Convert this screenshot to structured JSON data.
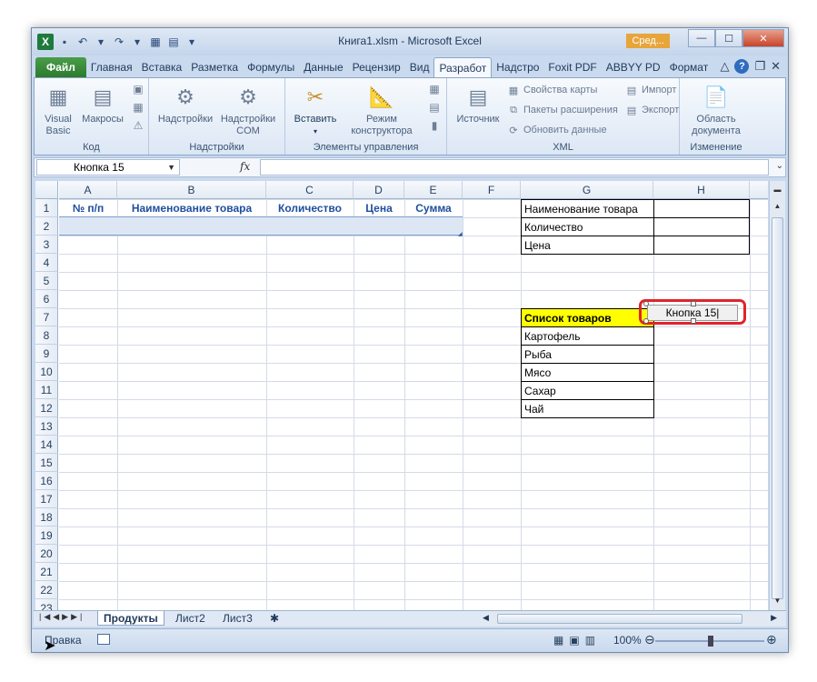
{
  "window": {
    "title": "Книга1.xlsm - Microsoft Excel",
    "search_badge": "Сред...",
    "controls": {
      "minimize": "—",
      "maximize": "☐",
      "close": "✕"
    }
  },
  "tabs": [
    {
      "label": "Файл",
      "active": false
    },
    {
      "label": "Главная"
    },
    {
      "label": "Вставка"
    },
    {
      "label": "Разметка"
    },
    {
      "label": "Формулы"
    },
    {
      "label": "Данные"
    },
    {
      "label": "Рецензир"
    },
    {
      "label": "Вид"
    },
    {
      "label": "Разработ",
      "active": true
    },
    {
      "label": "Надстро"
    },
    {
      "label": "Foxit PDF"
    },
    {
      "label": "ABBYY PD"
    },
    {
      "label": "Формат"
    }
  ],
  "ribbon": {
    "code_group": {
      "label": "Код",
      "visual_basic": "Visual\nBasic",
      "macros": "Макросы"
    },
    "addins_group": {
      "label": "Надстройки",
      "addins": "Надстройки",
      "com_addins": "Надстройки\nCOM"
    },
    "controls_group": {
      "label": "Элементы управления",
      "insert": "Вставить",
      "design_mode": "Режим\nконструктора"
    },
    "xml_group": {
      "label": "XML",
      "source": "Источник",
      "map_properties": "Свойства карты",
      "expansion_packs": "Пакеты расширения",
      "refresh_data": "Обновить данные",
      "import": "Импорт",
      "export": "Экспорт"
    },
    "modify_group": {
      "label": "Изменение",
      "document_panel": "Область\nдокумента"
    }
  },
  "formula_bar": {
    "name_box": "Кнопка 15",
    "fx": "fx",
    "value": ""
  },
  "columns": [
    "A",
    "B",
    "C",
    "D",
    "E",
    "F",
    "G",
    "H"
  ],
  "rows": [
    "1",
    "2",
    "3",
    "4",
    "5",
    "6",
    "7",
    "8",
    "9",
    "10",
    "11",
    "12",
    "13",
    "14",
    "15",
    "16",
    "17",
    "18",
    "19",
    "20",
    "21",
    "22",
    "23"
  ],
  "table_headers": {
    "a1": "№ п/п",
    "b1": "Наименование товара",
    "c1": "Количество",
    "d1": "Цена",
    "e1": "Сумма"
  },
  "form_labels": {
    "g1": "Наименование товара",
    "g2": "Количество",
    "g3": "Цена"
  },
  "product_list": {
    "header": "Список товаров",
    "items": [
      "Картофель",
      "Рыба",
      "Мясо",
      "Сахар",
      "Чай"
    ]
  },
  "button_shape": {
    "label": "Кнопка 15"
  },
  "sheets": [
    {
      "label": "Продукты",
      "active": true
    },
    {
      "label": "Лист2"
    },
    {
      "label": "Лист3"
    }
  ],
  "status": {
    "mode": "Правка",
    "zoom": "100%"
  }
}
